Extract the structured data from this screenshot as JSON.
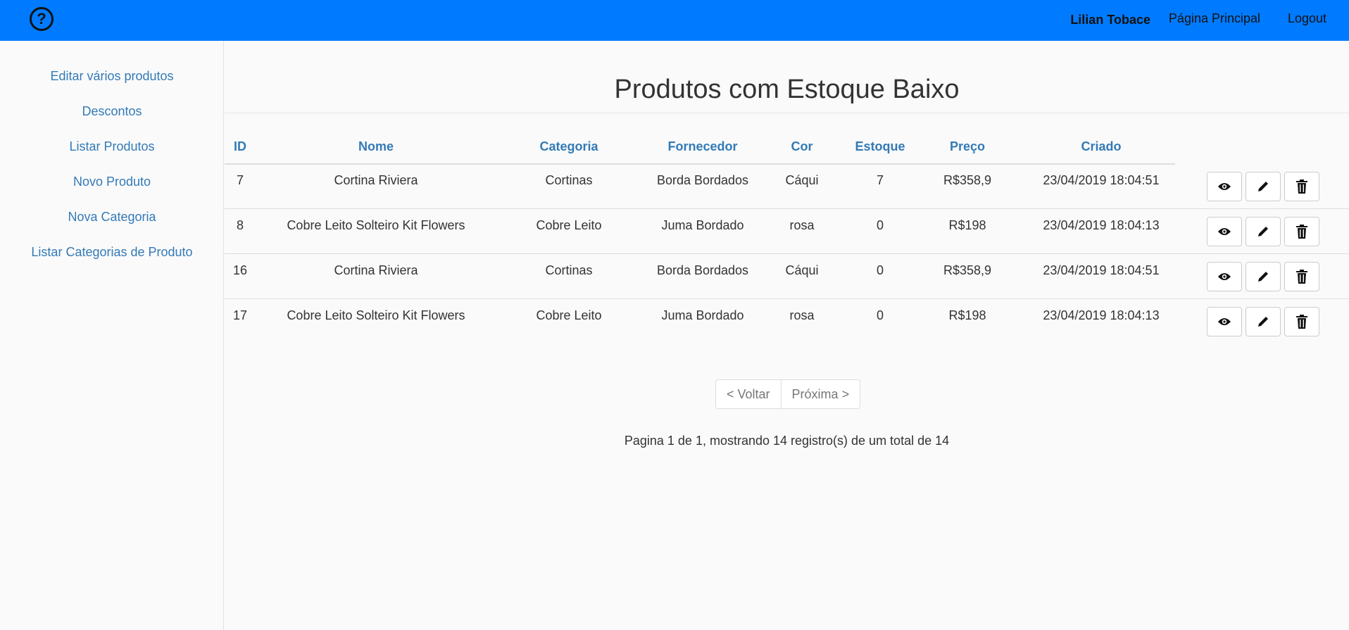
{
  "navbar": {
    "help_icon": "question-circle-icon",
    "user_name": "Lilian Tobace",
    "home_label": "Página Principal",
    "logout_label": "Logout",
    "color": "#007bff"
  },
  "sidebar": {
    "items": [
      {
        "label": "Editar vários produtos"
      },
      {
        "label": "Descontos"
      },
      {
        "label": "Listar Produtos"
      },
      {
        "label": "Novo Produto"
      },
      {
        "label": "Nova Categoria"
      },
      {
        "label": "Listar Categorias de Produto"
      }
    ]
  },
  "main": {
    "title": "Produtos com Estoque Baixo",
    "columns": [
      "ID",
      "Nome",
      "Categoria",
      "Fornecedor",
      "Cor",
      "Estoque",
      "Preço",
      "Criado"
    ],
    "rows": [
      {
        "id": "7",
        "nome": "Cortina Riviera",
        "categoria": "Cortinas",
        "fornecedor": "Borda Bordados",
        "cor": "Cáqui",
        "estoque": "7",
        "preco": "R$358,9",
        "criado": "23/04/2019 18:04:51"
      },
      {
        "id": "8",
        "nome": "Cobre Leito Solteiro Kit Flowers",
        "categoria": "Cobre Leito",
        "fornecedor": "Juma Bordado",
        "cor": "rosa",
        "estoque": "0",
        "preco": "R$198",
        "criado": "23/04/2019 18:04:13"
      },
      {
        "id": "16",
        "nome": "Cortina Riviera",
        "categoria": "Cortinas",
        "fornecedor": "Borda Bordados",
        "cor": "Cáqui",
        "estoque": "0",
        "preco": "R$358,9",
        "criado": "23/04/2019 18:04:51"
      },
      {
        "id": "17",
        "nome": "Cobre Leito Solteiro Kit Flowers",
        "categoria": "Cobre Leito",
        "fornecedor": "Juma Bordado",
        "cor": "rosa",
        "estoque": "0",
        "preco": "R$198",
        "criado": "23/04/2019 18:04:13"
      }
    ],
    "row_actions": [
      "eye-icon",
      "pencil-icon",
      "trash-icon"
    ]
  },
  "pagination": {
    "prev_label": "< Voltar",
    "next_label": "Próxima >",
    "info": "Pagina 1 de 1, mostrando 14 registro(s) de um total de 14"
  }
}
